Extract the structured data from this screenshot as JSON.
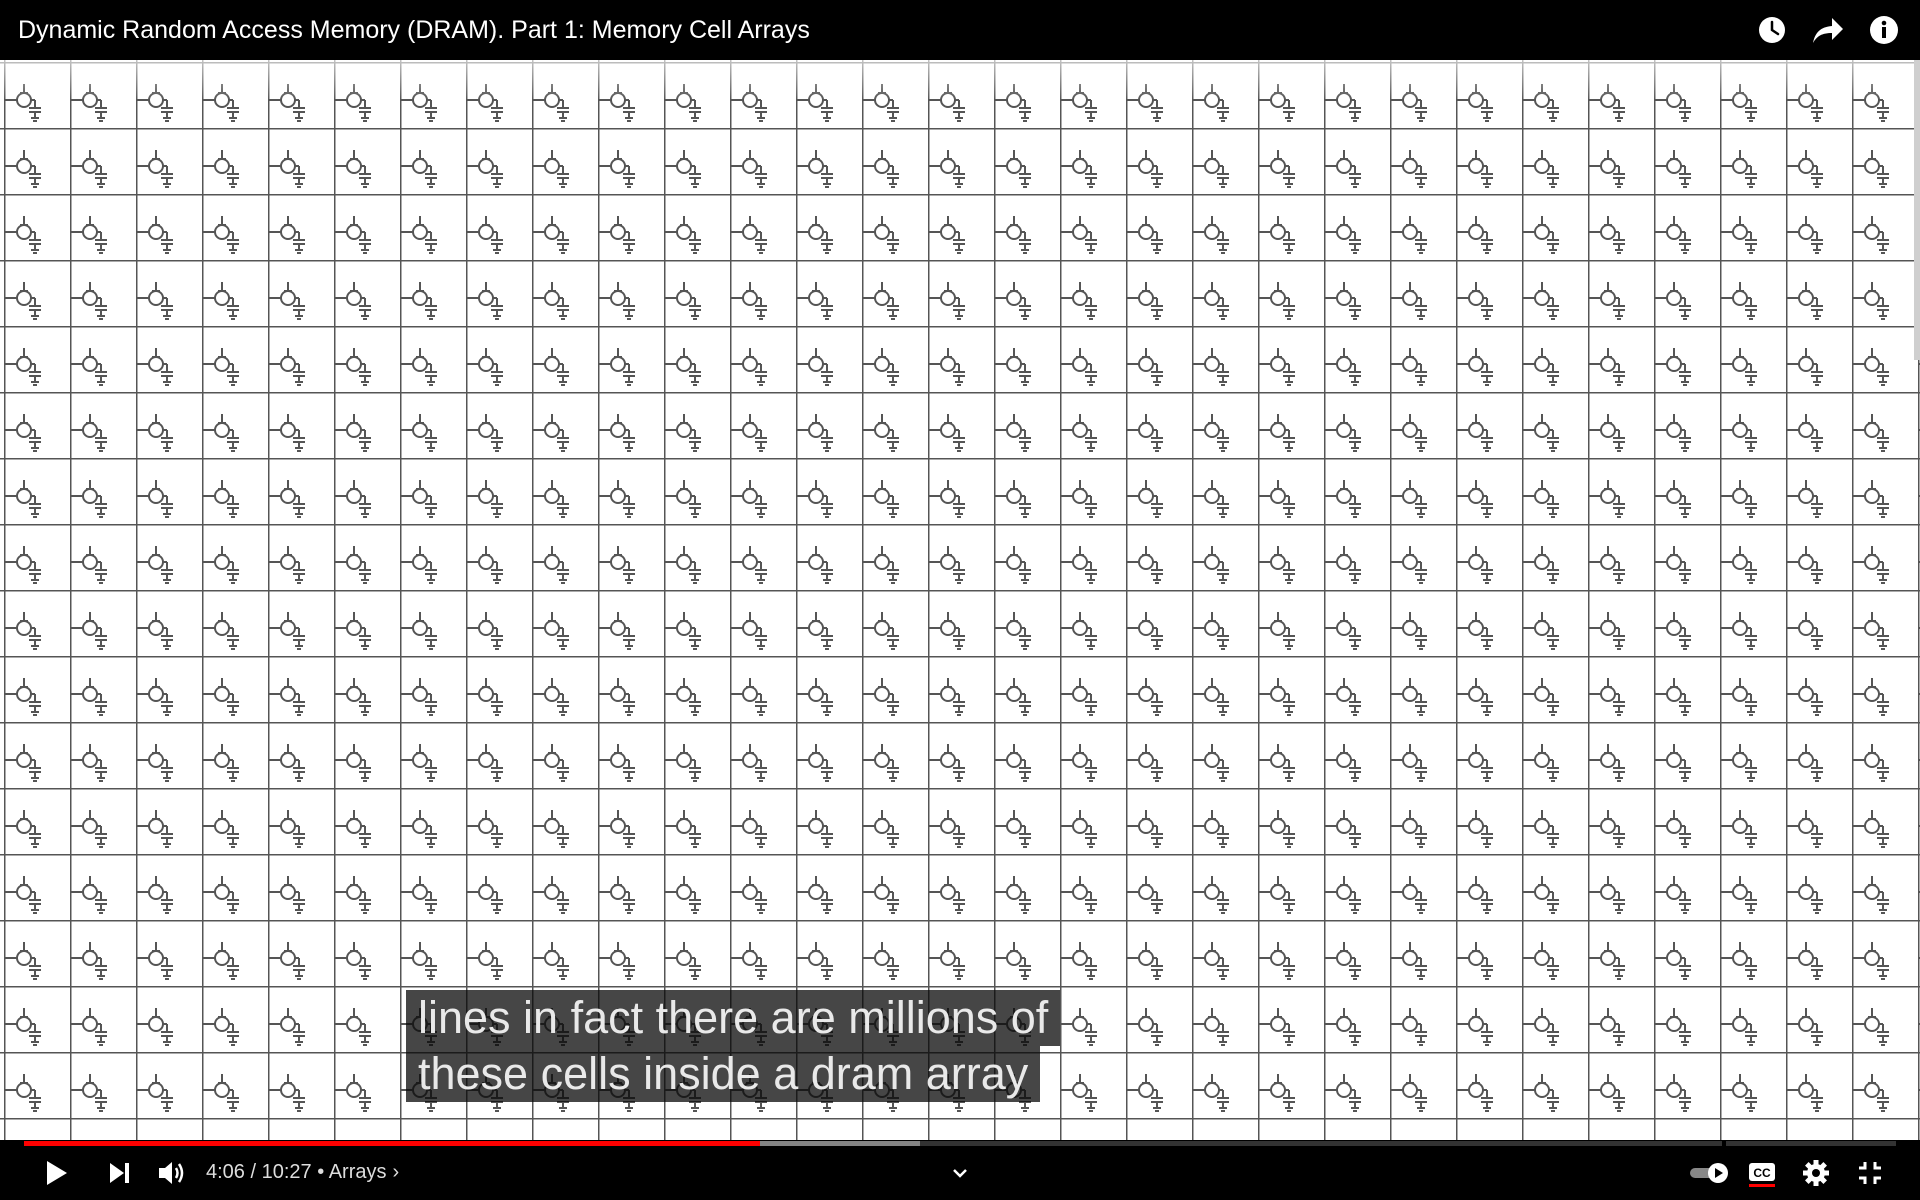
{
  "video": {
    "title": "Dynamic Random Access Memory (DRAM). Part 1: Memory Cell Arrays"
  },
  "captions": {
    "line1": "lines in fact there are millions of",
    "line2": "these cells inside a dram array"
  },
  "player": {
    "current_time": "4:06",
    "separator": " / ",
    "duration": "10:27",
    "chapter_prefix": " • ",
    "chapter": "Arrays",
    "chapter_chevron": "›",
    "progress_fraction": 0.393,
    "accent_color": "#ff0000"
  },
  "icons": {
    "top": [
      "watch-later-icon",
      "share-icon",
      "info-icon"
    ],
    "bottom": [
      "play-icon",
      "next-icon",
      "volume-icon",
      "chevron-down-icon",
      "autoplay-toggle-icon",
      "captions-icon",
      "settings-icon",
      "exit-fullscreen-icon"
    ]
  }
}
